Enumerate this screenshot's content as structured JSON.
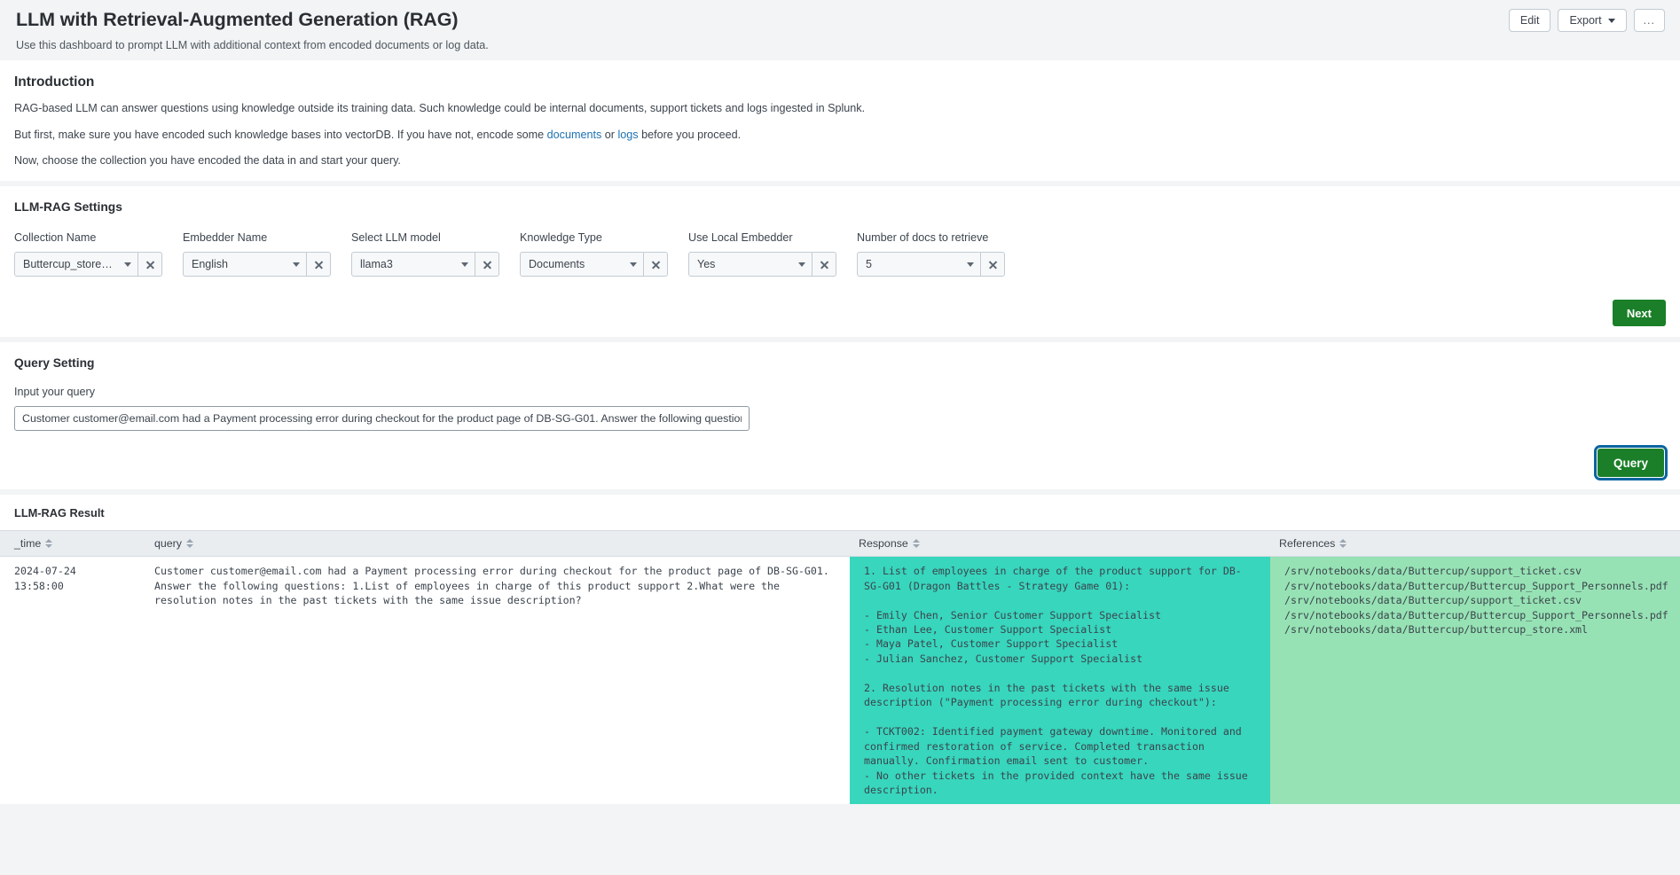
{
  "header": {
    "title": "LLM with Retrieval-Augmented Generation (RAG)",
    "subtitle": "Use this dashboard to prompt LLM with additional context from encoded documents or log data.",
    "edit_label": "Edit",
    "export_label": "Export",
    "more_label": "..."
  },
  "introduction": {
    "heading": "Introduction",
    "p1": "RAG-based LLM can answer questions using knowledge outside its training data. Such knowledge could be internal documents, support tickets and logs ingested in Splunk.",
    "p2_a": "But first, make sure you have encoded such knowledge bases into vectorDB. If you have not, encode some ",
    "p2_link1": "documents",
    "p2_b": " or ",
    "p2_link2": "logs",
    "p2_c": " before you proceed.",
    "p3": "Now, choose the collection you have encoded the data in and start your query."
  },
  "settings": {
    "title": "LLM-RAG Settings",
    "fields": [
      {
        "label": "Collection Name",
        "value": "Buttercup_store_in...",
        "clear": "clear-icon"
      },
      {
        "label": "Embedder Name",
        "value": "English",
        "clear": "clear-icon"
      },
      {
        "label": "Select LLM model",
        "value": "llama3",
        "clear": "clear-icon"
      },
      {
        "label": "Knowledge Type",
        "value": "Documents",
        "clear": "clear-icon"
      },
      {
        "label": "Use Local Embedder",
        "value": "Yes",
        "clear": "clear-icon"
      },
      {
        "label": "Number of docs to retrieve",
        "value": "5",
        "clear": "clear-icon"
      }
    ],
    "next_label": "Next"
  },
  "query_setting": {
    "title": "Query Setting",
    "input_label": "Input your query",
    "input_value": "Customer customer@email.com had a Payment processing error during checkout for the product page of DB-SG-G01. Answer the following questions: 1.List of employees in charge of this product support 2.What were the resolution notes in the past tickets with the same issue description?",
    "placeholder": "Input your query",
    "query_label": "Query"
  },
  "result": {
    "title": "LLM-RAG Result",
    "columns": [
      "_time",
      "query",
      "Response",
      "References"
    ],
    "rows": [
      {
        "time": "2024-07-24 13:58:00",
        "query": "Customer customer@email.com had a Payment processing error during checkout for the product page of DB-SG-G01. Answer the following questions: 1.List of employees in charge of this product support 2.What were the resolution notes in the past tickets with the same issue description?",
        "response": "1. List of employees in charge of the product support for DB-SG-G01 (Dragon Battles - Strategy Game 01):\n\n- Emily Chen, Senior Customer Support Specialist\n- Ethan Lee, Customer Support Specialist\n- Maya Patel, Customer Support Specialist\n- Julian Sanchez, Customer Support Specialist\n\n2. Resolution notes in the past tickets with the same issue description (\"Payment processing error during checkout\"):\n\n- TCKT002: Identified payment gateway downtime. Monitored and confirmed restoration of service. Completed transaction manually. Confirmation email sent to customer.\n- No other tickets in the provided context have the same issue description.",
        "references": "/srv/notebooks/data/Buttercup/support_ticket.csv\n/srv/notebooks/data/Buttercup/Buttercup_Support_Personnels.pdf\n/srv/notebooks/data/Buttercup/support_ticket.csv\n/srv/notebooks/data/Buttercup/Buttercup_Support_Personnels.pdf\n/srv/notebooks/data/Buttercup/buttercup_store.xml"
      }
    ]
  },
  "colors": {
    "accent_green": "#1a7f28",
    "response_bg": "#37d6bd",
    "references_bg": "#96e2b4",
    "link_blue": "#1d72b0",
    "focus_ring": "#0b65a0"
  }
}
